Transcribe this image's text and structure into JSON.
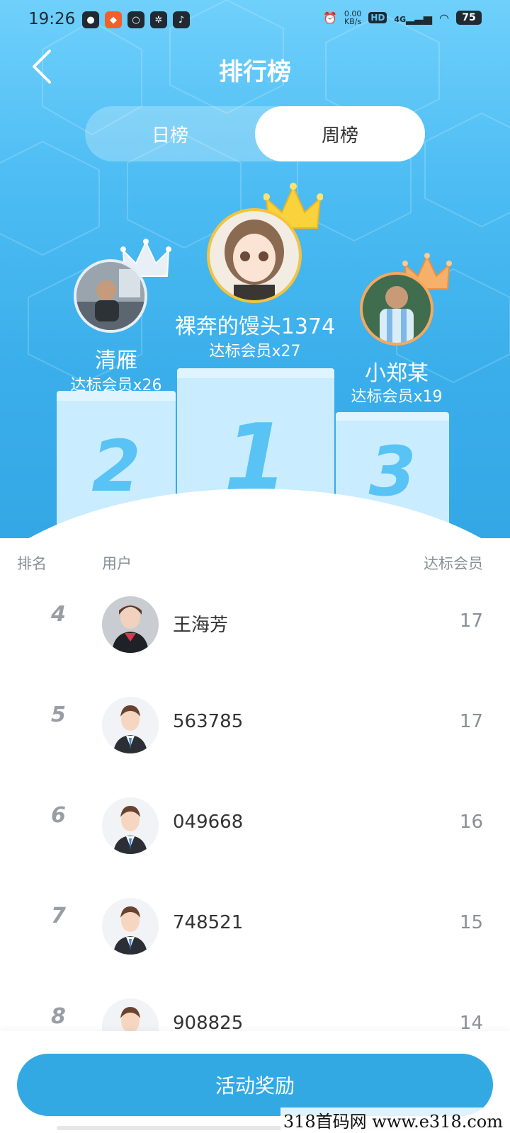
{
  "status_bar": {
    "time": "19:26",
    "speed_value": "0.00",
    "speed_unit": "KB/s",
    "hd": "HD",
    "network": "4G",
    "battery": "75"
  },
  "header": {
    "title": "排行榜"
  },
  "tabs": [
    {
      "label": "日榜",
      "active": false
    },
    {
      "label": "周榜",
      "active": true
    }
  ],
  "podium": {
    "first": {
      "rank": "1",
      "name": "裸奔的馒头1374",
      "subtitle": "达标会员x27",
      "crown_color": "#f5c33c"
    },
    "second": {
      "rank": "2",
      "name": "清雁",
      "subtitle": "达标会员x26",
      "crown_color": "#dfe6ee"
    },
    "third": {
      "rank": "3",
      "name": "小郑某",
      "subtitle": "达标会员x19",
      "crown_color": "#f6a85d"
    }
  },
  "list_header": {
    "rank": "排名",
    "user": "用户",
    "count": "达标会员"
  },
  "rows": [
    {
      "rank": "4",
      "name": "王海芳",
      "count": "17",
      "avatar": "photo"
    },
    {
      "rank": "5",
      "name": "563785",
      "count": "17",
      "avatar": "default"
    },
    {
      "rank": "6",
      "name": "049668",
      "count": "16",
      "avatar": "default"
    },
    {
      "rank": "7",
      "name": "748521",
      "count": "15",
      "avatar": "default"
    },
    {
      "rank": "8",
      "name": "908825",
      "count": "14",
      "avatar": "default"
    }
  ],
  "bottom": {
    "reward_button": "活动奖励"
  },
  "watermark": "318首码网  www.e318.com",
  "colors": {
    "primary": "#33a9e4",
    "hero_top": "#6fd0fb",
    "podium": "#c9ecff",
    "podium_number": "#59c3f5"
  }
}
